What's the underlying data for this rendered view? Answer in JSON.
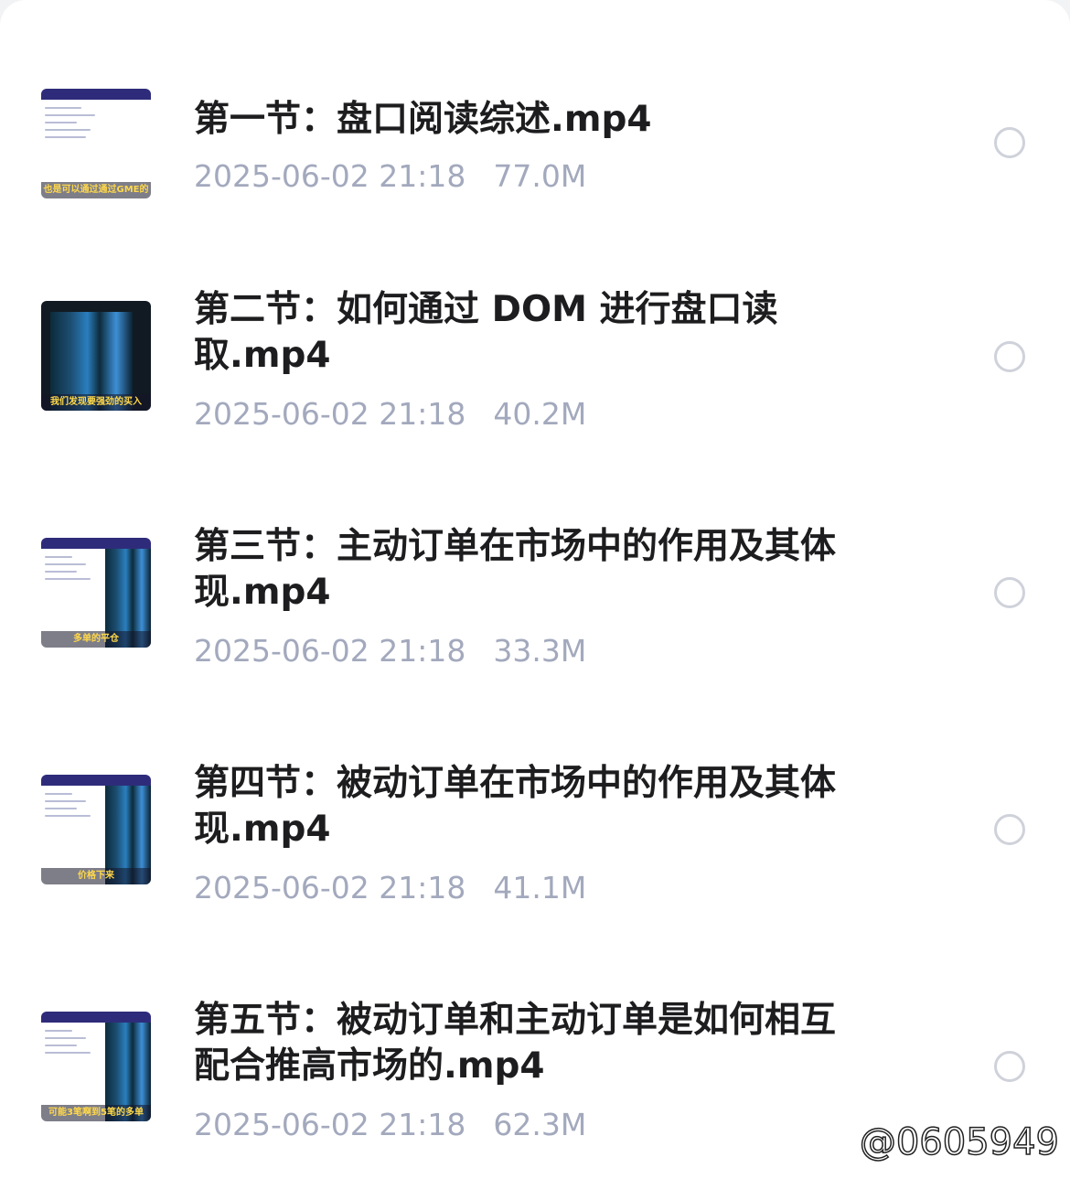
{
  "files": [
    {
      "title": "第一节：盘口阅读综述.mp4",
      "date": "2025-06-02 21:18",
      "size": "77.0M",
      "thumb_caption": "也是可以通过通过GME的",
      "selected": false
    },
    {
      "title": "第二节：如何通过 DOM 进行盘口读取.mp4",
      "date": "2025-06-02 21:18",
      "size": "40.2M",
      "thumb_caption": "我们发现要强劲的买入",
      "selected": false
    },
    {
      "title": "第三节：主动订单在市场中的作用及其体现.mp4",
      "date": "2025-06-02 21:18",
      "size": "33.3M",
      "thumb_caption": "多单的平仓",
      "selected": false
    },
    {
      "title": "第四节：被动订单在市场中的作用及其体现.mp4",
      "date": "2025-06-02 21:18",
      "size": "41.1M",
      "thumb_caption": "价格下来",
      "selected": false
    },
    {
      "title": "第五节：被动订单和主动订单是如何相互配合推高市场的.mp4",
      "date": "2025-06-02 21:18",
      "size": "62.3M",
      "thumb_caption": "可能3笔啊到5笔的多单",
      "selected": false
    }
  ],
  "watermark": "@0605949",
  "colors": {
    "title": "#1d1d1f",
    "meta": "#a3a9bd",
    "circle": "#cfd2da",
    "thumb_header": "#2e2c7a"
  }
}
